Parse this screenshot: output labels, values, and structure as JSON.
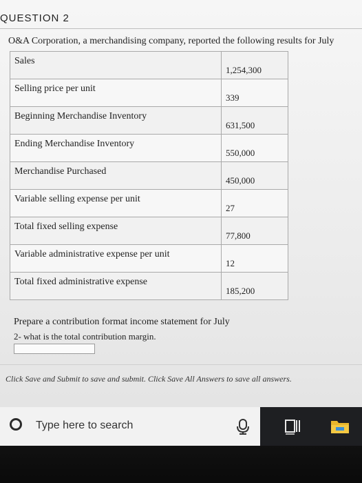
{
  "question": {
    "header": "QUESTION 2"
  },
  "intro": "O&A Corporation, a merchandising company, reported the following results for July",
  "table": {
    "rows": [
      {
        "label": "Sales",
        "value": "1,254,300"
      },
      {
        "label": "Selling price per unit",
        "value": "339"
      },
      {
        "label": "Beginning Merchandise Inventory",
        "value": "631,500"
      },
      {
        "label": "Ending Merchandise Inventory",
        "value": "550,000"
      },
      {
        "label": "Merchandise Purchased",
        "value": "450,000"
      },
      {
        "label": "Variable selling expense per unit",
        "value": "27"
      },
      {
        "label": "Total fixed selling expense",
        "value": "77,800"
      },
      {
        "label": "Variable administrative expense per unit",
        "value": "12"
      },
      {
        "label": "Total fixed administrative expense",
        "value": "185,200"
      }
    ]
  },
  "prompt": {
    "line1": "Prepare a contribution format income statement for July",
    "line2": "2- what is the total contribution margin.",
    "answer_value": ""
  },
  "footer": {
    "note": "Click Save and Submit to save and submit. Click Save All Answers to save all answers."
  },
  "taskbar": {
    "search_placeholder": "Type here to search",
    "icons": [
      "search-circle-icon",
      "microphone-icon",
      "task-view-icon",
      "file-explorer-icon"
    ]
  }
}
